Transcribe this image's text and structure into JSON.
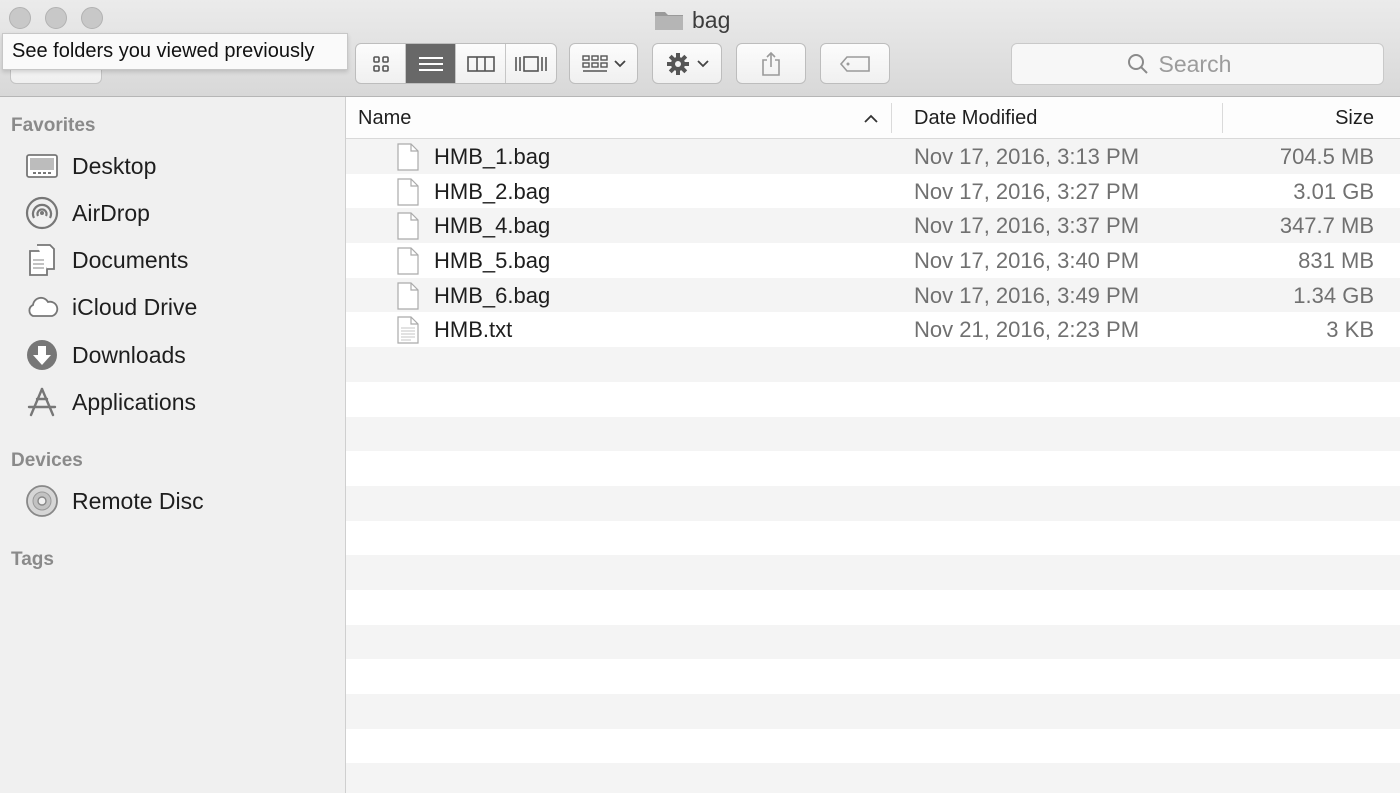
{
  "window": {
    "title": "bag",
    "tooltip": "See folders you viewed previously"
  },
  "toolbar": {
    "search_placeholder": "Search",
    "view_mode": "list"
  },
  "sidebar": {
    "sections": [
      {
        "heading": "Favorites"
      },
      {
        "heading": "Devices"
      },
      {
        "heading": "Tags"
      }
    ],
    "favorites": [
      {
        "label": "Desktop",
        "icon": "desktop-icon"
      },
      {
        "label": "AirDrop",
        "icon": "airdrop-icon"
      },
      {
        "label": "Documents",
        "icon": "documents-icon"
      },
      {
        "label": "iCloud Drive",
        "icon": "cloud-icon"
      },
      {
        "label": "Downloads",
        "icon": "downloads-icon"
      },
      {
        "label": "Applications",
        "icon": "applications-icon"
      }
    ],
    "devices": [
      {
        "label": "Remote Disc",
        "icon": "disc-icon"
      }
    ]
  },
  "columns": {
    "name": "Name",
    "date": "Date Modified",
    "size": "Size",
    "sort_indicator": "^"
  },
  "files": [
    {
      "name": "HMB_1.bag",
      "date": "Nov 17, 2016, 3:13 PM",
      "size": "704.5 MB",
      "icon": "file-icon"
    },
    {
      "name": "HMB_2.bag",
      "date": "Nov 17, 2016, 3:27 PM",
      "size": "3.01 GB",
      "icon": "file-icon"
    },
    {
      "name": "HMB_4.bag",
      "date": "Nov 17, 2016, 3:37 PM",
      "size": "347.7 MB",
      "icon": "file-icon"
    },
    {
      "name": "HMB_5.bag",
      "date": "Nov 17, 2016, 3:40 PM",
      "size": "831 MB",
      "icon": "file-icon"
    },
    {
      "name": "HMB_6.bag",
      "date": "Nov 17, 2016, 3:49 PM",
      "size": "1.34 GB",
      "icon": "file-icon"
    },
    {
      "name": "HMB.txt",
      "date": "Nov 21, 2016, 2:23 PM",
      "size": "3 KB",
      "icon": "text-file-icon"
    }
  ]
}
